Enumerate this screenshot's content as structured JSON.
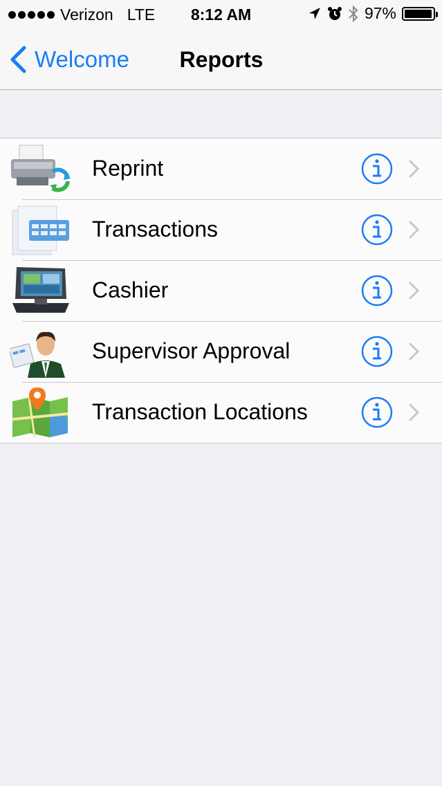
{
  "status_bar": {
    "carrier": "Verizon",
    "network": "LTE",
    "time": "8:12 AM",
    "battery": "97%",
    "battery_level": 0.97,
    "icons": [
      "signal-dots-icon",
      "location-arrow-icon",
      "alarm-icon",
      "bluetooth-icon",
      "battery-icon"
    ]
  },
  "nav": {
    "back_label": "Welcome",
    "title": "Reports"
  },
  "rows": [
    {
      "label": "Reprint",
      "icon": "printer-icon"
    },
    {
      "label": "Transactions",
      "icon": "transactions-document-icon"
    },
    {
      "label": "Cashier",
      "icon": "pos-terminal-icon"
    },
    {
      "label": "Supervisor Approval",
      "icon": "supervisor-icon"
    },
    {
      "label": "Transaction Locations",
      "icon": "map-pin-icon"
    }
  ],
  "colors": {
    "accent": "#1b7cf5",
    "background": "#efeff4",
    "separator": "#c8c7cc",
    "chevron": "#c7c7cc"
  }
}
